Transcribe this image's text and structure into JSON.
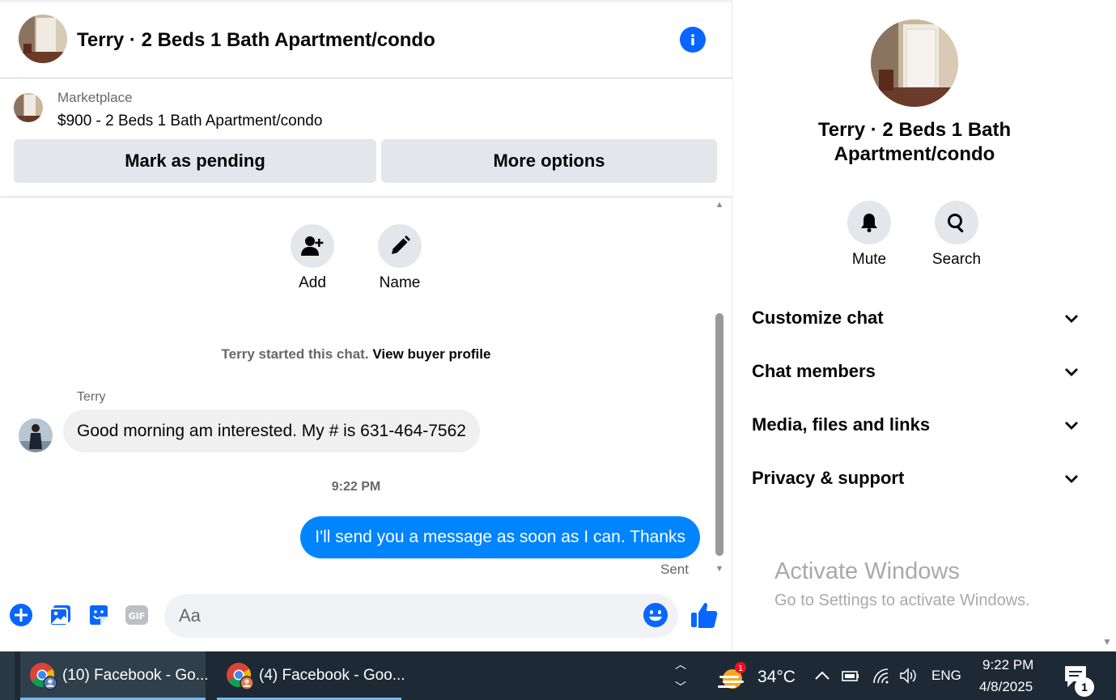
{
  "header": {
    "title": "Terry · 2 Beds 1 Bath Apartment/condo"
  },
  "marketplace": {
    "label": "Marketplace",
    "listing": "$900 - 2 Beds 1 Bath Apartment/condo",
    "pending_button": "Mark as pending",
    "more_button": "More options"
  },
  "thread": {
    "add_label": "Add",
    "name_label": "Name",
    "started_text": "Terry started this chat.",
    "buyer_profile_link": "View buyer profile",
    "sender_name": "Terry",
    "incoming_message": "Good morning am interested. My # is 631-464-7562",
    "time_separator": "9:22 PM",
    "outgoing_message": "I'll send you a message as soon as I can. Thanks",
    "status": "Sent"
  },
  "composer": {
    "placeholder": "Aa",
    "gif_label": "GIF"
  },
  "details": {
    "title": "Terry · 2 Beds 1 Bath Apartment/condo",
    "mute_label": "Mute",
    "search_label": "Search",
    "sections": [
      {
        "label": "Customize chat"
      },
      {
        "label": "Chat members"
      },
      {
        "label": "Media, files and links"
      },
      {
        "label": "Privacy & support"
      }
    ]
  },
  "watermark": {
    "title": "Activate Windows",
    "subtitle": "Go to Settings to activate Windows."
  },
  "taskbar": {
    "windows": [
      {
        "label": "(10) Facebook - Go..."
      },
      {
        "label": "(4) Facebook - Goo..."
      }
    ],
    "weather_badge": "1",
    "temperature": "34°C",
    "language": "ENG",
    "time": "9:22 PM",
    "date": "4/8/2025",
    "notification_count": "1"
  },
  "colors": {
    "accent": "#0866ff",
    "outgoing_bubble": "#0084ff",
    "incoming_bubble": "#f0f0f0",
    "taskbar": "#1d2a35"
  }
}
